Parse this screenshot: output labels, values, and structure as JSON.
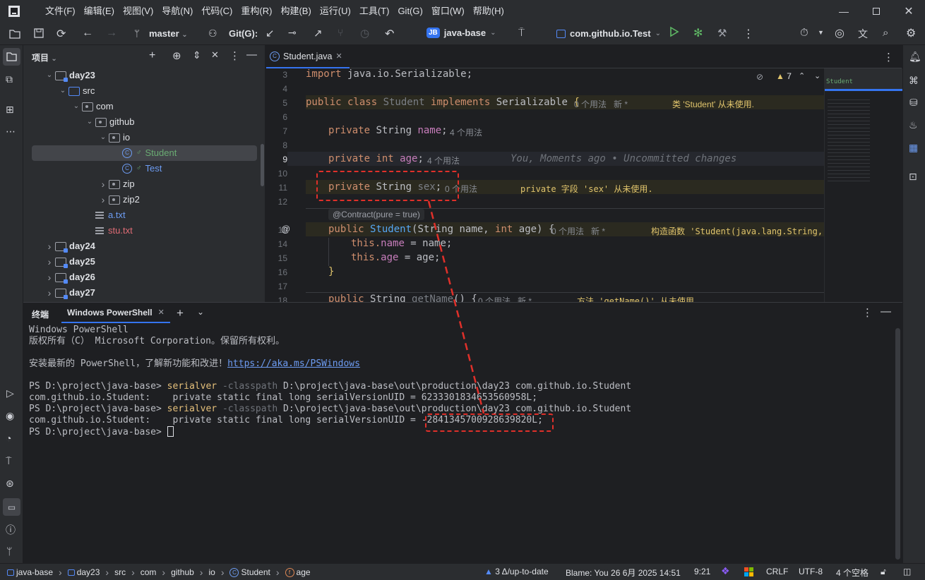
{
  "menu": [
    "文件(F)",
    "编辑(E)",
    "视图(V)",
    "导航(N)",
    "代码(C)",
    "重构(R)",
    "构建(B)",
    "运行(U)",
    "工具(T)",
    "Git(G)",
    "窗口(W)",
    "帮助(H)"
  ],
  "toolbar": {
    "branch": "master",
    "git_label": "Git(G):",
    "project_badge": "JB",
    "project": "java-base",
    "run_config": "com.github.io.Test"
  },
  "project_panel": {
    "title": "项目"
  },
  "tree": [
    {
      "label": "day23",
      "indent": 1,
      "type": "folder",
      "open": true
    },
    {
      "label": "src",
      "indent": 2,
      "type": "folder-blue",
      "open": true
    },
    {
      "label": "com",
      "indent": 3,
      "type": "pkg",
      "open": true
    },
    {
      "label": "github",
      "indent": 4,
      "type": "pkg",
      "open": true
    },
    {
      "label": "io",
      "indent": 5,
      "type": "pkg",
      "open": true
    },
    {
      "label": "Student",
      "indent": 6,
      "type": "class",
      "selected": true,
      "color": "#6aab73"
    },
    {
      "label": "Test",
      "indent": 6,
      "type": "class-test",
      "color": "#6d9cf2"
    },
    {
      "label": "zip",
      "indent": 5,
      "type": "pkg",
      "open": false
    },
    {
      "label": "zip2",
      "indent": 5,
      "type": "pkg",
      "open": false
    },
    {
      "label": "a.txt",
      "indent": 4,
      "type": "txt",
      "color": "#6d9cf2"
    },
    {
      "label": "stu.txt",
      "indent": 4,
      "type": "txt",
      "color": "#e06c75"
    },
    {
      "label": "day24",
      "indent": 1,
      "type": "folder",
      "open": false
    },
    {
      "label": "day25",
      "indent": 1,
      "type": "folder",
      "open": false
    },
    {
      "label": "day26",
      "indent": 1,
      "type": "folder",
      "open": false
    },
    {
      "label": "day27",
      "indent": 1,
      "type": "folder",
      "open": false
    }
  ],
  "editor": {
    "tab": "Student.java",
    "warnings": "7",
    "minimap_label": "Student",
    "lines": {
      "l3": {
        "num": "3",
        "kw": "import",
        "rest": " java.io.Serializable;"
      },
      "l4": {
        "num": "4"
      },
      "l5": {
        "num": "5",
        "a": "public class ",
        "b": "Student ",
        "c": "implements ",
        "d": "Serializable ",
        "e": "{",
        "hint": "0 个用法   新 *",
        "warn": "类 'Student' 从未使用."
      },
      "l6": {
        "num": "6"
      },
      "l7": {
        "num": "7",
        "a": "private ",
        "b": "String ",
        "c": "name",
        "d": ";",
        "hint": "4 个用法"
      },
      "l8": {
        "num": "8"
      },
      "l9": {
        "num": "9",
        "a": "private ",
        "b": "int ",
        "c": "age",
        "d": ";",
        "hint": "4 个用法",
        "blame": "You, Moments ago • Uncommitted changes"
      },
      "l10": {
        "num": "10"
      },
      "l11": {
        "num": "11",
        "a": "private ",
        "b": "String ",
        "c": "sex",
        "d": ";",
        "hint": "0 个用法",
        "warn": "private 字段 'sex' 从未使用."
      },
      "l12": {
        "num": "12"
      },
      "contract": "@Contract(pure = true)",
      "l13": {
        "num": "13",
        "a": "public ",
        "b": "Student",
        "c": "(String name, ",
        "d": "int ",
        "e": "age) {",
        "hint": "0 个用法   新 *",
        "warn": "构造函数 'Student(java.lang.String,"
      },
      "l14": {
        "num": "14",
        "a": "this.",
        "b": "name",
        "c": " = name;"
      },
      "l15": {
        "num": "15",
        "a": "this.",
        "b": "age",
        "c": " = age;"
      },
      "l16": {
        "num": "16",
        "a": "}"
      },
      "l17": {
        "num": "17"
      },
      "l18": {
        "num": "18",
        "a": "public ",
        "b": "String ",
        "c": "getName",
        "d": "() {",
        "hint": "0 个用法   新 *",
        "warn": "方法 'getName()' 从未使用."
      }
    }
  },
  "terminal": {
    "title": "终端",
    "tab": "Windows PowerShell",
    "lines": {
      "t1": "Windows PowerShell",
      "t2": "版权所有（C） Microsoft Corporation。保留所有权利。",
      "t3a": "安装最新的 PowerShell，了解新功能和改进！",
      "t3link": "https://aka.ms/PSWindows",
      "prompt": "PS D:\\project\\java-base> ",
      "cmd": "serialver",
      "param": " -classpath ",
      "args": "D:\\project\\java-base\\out\\production\\day23 com.github.io.Student",
      "out1": "com.github.io.Student:    private static final long serialVersionUID = 6233301834653560958L;",
      "out2a": "com.github.io.Student:    private static final long serialVersionUID = ",
      "out2b": "-2841345700928639820L;",
      "prompt3": "PS D:\\project\\java-base> "
    }
  },
  "status": {
    "crumbs": [
      "java-base",
      "day23",
      "src",
      "com",
      "github",
      "io",
      "Student",
      "age"
    ],
    "git": "3 Δ/up-to-date",
    "blame": "Blame: You 26 6月 2025 14:51",
    "pos": "9:21",
    "crlf": "CRLF",
    "enc": "UTF-8",
    "indent": "4 个空格"
  }
}
